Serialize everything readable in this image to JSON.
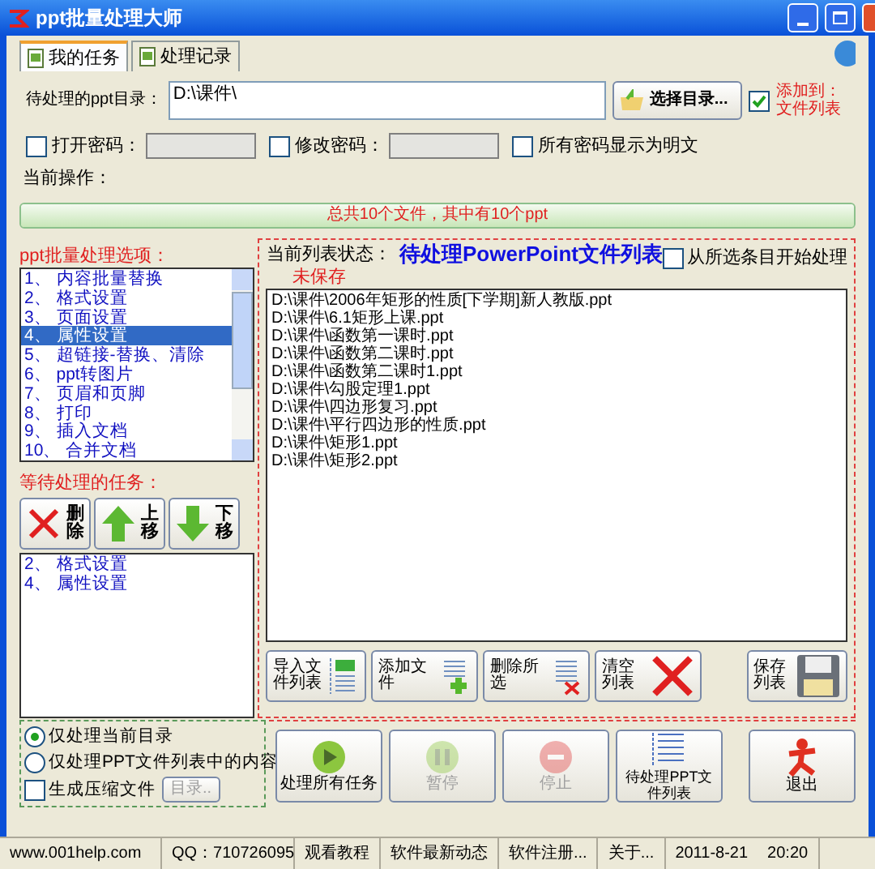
{
  "window": {
    "title": "ppt批量处理大师"
  },
  "tabs": [
    {
      "label": "我的任务",
      "selected": true
    },
    {
      "label": "处理记录",
      "selected": false
    }
  ],
  "path": {
    "label": "待处理的ppt目录：",
    "value": "D:\\课件\\"
  },
  "browse_button": {
    "label": "选择目录..."
  },
  "add_to": {
    "label_1": "添加到：",
    "label_2": "文件列表",
    "checked": true
  },
  "passwords": [
    {
      "label": "打开密码：",
      "checked": false,
      "kind": "field"
    },
    {
      "label": "修改密码：",
      "checked": false,
      "kind": "field"
    },
    {
      "label": "所有密码显示为明文",
      "checked": false,
      "kind": "plain"
    }
  ],
  "current_op": {
    "label": "当前操作："
  },
  "progress": {
    "text": "总共10个文件，其中有10个ppt",
    "level": 1
  },
  "options": {
    "title": "ppt批量处理选项：",
    "items": [
      {
        "label": "1、 内容批量替换",
        "selected": false
      },
      {
        "label": "2、 格式设置",
        "selected": false
      },
      {
        "label": "3、 页面设置",
        "selected": false
      },
      {
        "label": "4、 属性设置",
        "selected": true
      },
      {
        "label": "5、 超链接-替换、清除",
        "selected": false
      },
      {
        "label": "6、 ppt转图片",
        "selected": false
      },
      {
        "label": "7、 页眉和页脚",
        "selected": false
      },
      {
        "label": "8、 打印",
        "selected": false
      },
      {
        "label": "9、 插入文档",
        "selected": false
      },
      {
        "label": "10、 合并文档",
        "selected": false
      }
    ]
  },
  "pending": {
    "title": "等待处理的任务：",
    "buttons": [
      {
        "label_1": "删",
        "label_2": "除",
        "kind": "delete"
      },
      {
        "label_1": "上",
        "label_2": "移",
        "kind": "up"
      },
      {
        "label_1": "下",
        "label_2": "移",
        "kind": "down"
      }
    ],
    "items": [
      "2、 格式设置",
      "4、 属性设置"
    ]
  },
  "file_list": {
    "status_label": "当前列表状态：",
    "status_value": "未保存",
    "title": "待处理PowerPoint文件列表",
    "start_from": {
      "label": "从所选条目开始处理",
      "checked": false
    },
    "files": [
      "D:\\课件\\2006年矩形的性质[下学期]新人教版.ppt",
      "D:\\课件\\6.1矩形上课.ppt",
      "D:\\课件\\函数第一课时.ppt",
      "D:\\课件\\函数第二课时.ppt",
      "D:\\课件\\函数第二课时1.ppt",
      "D:\\课件\\勾股定理1.ppt",
      "D:\\课件\\四边形复习.ppt",
      "D:\\课件\\平行四边形的性质.ppt",
      "D:\\课件\\矩形1.ppt",
      "D:\\课件\\矩形2.ppt"
    ],
    "buttons": [
      {
        "label": "导入文件列表",
        "kind": "import"
      },
      {
        "label": "添加文件",
        "kind": "add"
      },
      {
        "label": "删除所选",
        "kind": "remove"
      },
      {
        "label": "清空列表",
        "kind": "clear"
      },
      {
        "label": "保存列表",
        "kind": "save"
      }
    ]
  },
  "scope": {
    "radios": [
      {
        "label": "仅处理当前目录",
        "selected": true
      },
      {
        "label": "仅处理PPT文件列表中的内容",
        "selected": false
      }
    ],
    "compress": {
      "label": "生成压缩文件",
      "checked": false
    },
    "dir_button": {
      "label": "目录..",
      "disabled": true
    }
  },
  "actions": [
    {
      "label": "处理所有任务",
      "kind": "play",
      "disabled": false
    },
    {
      "label": "暂停",
      "kind": "pause",
      "disabled": true
    },
    {
      "label": "停止",
      "kind": "stop",
      "disabled": true
    },
    {
      "label": "待处理PPT文件列表",
      "kind": "list",
      "disabled": false
    },
    {
      "label": "退出",
      "kind": "exit",
      "disabled": false
    }
  ],
  "status_bar": [
    "www.001help.com",
    "QQ：710726095",
    "观看教程",
    "软件最新动态",
    "软件注册...",
    "关于...",
    "2011-8-21",
    "20:20"
  ]
}
